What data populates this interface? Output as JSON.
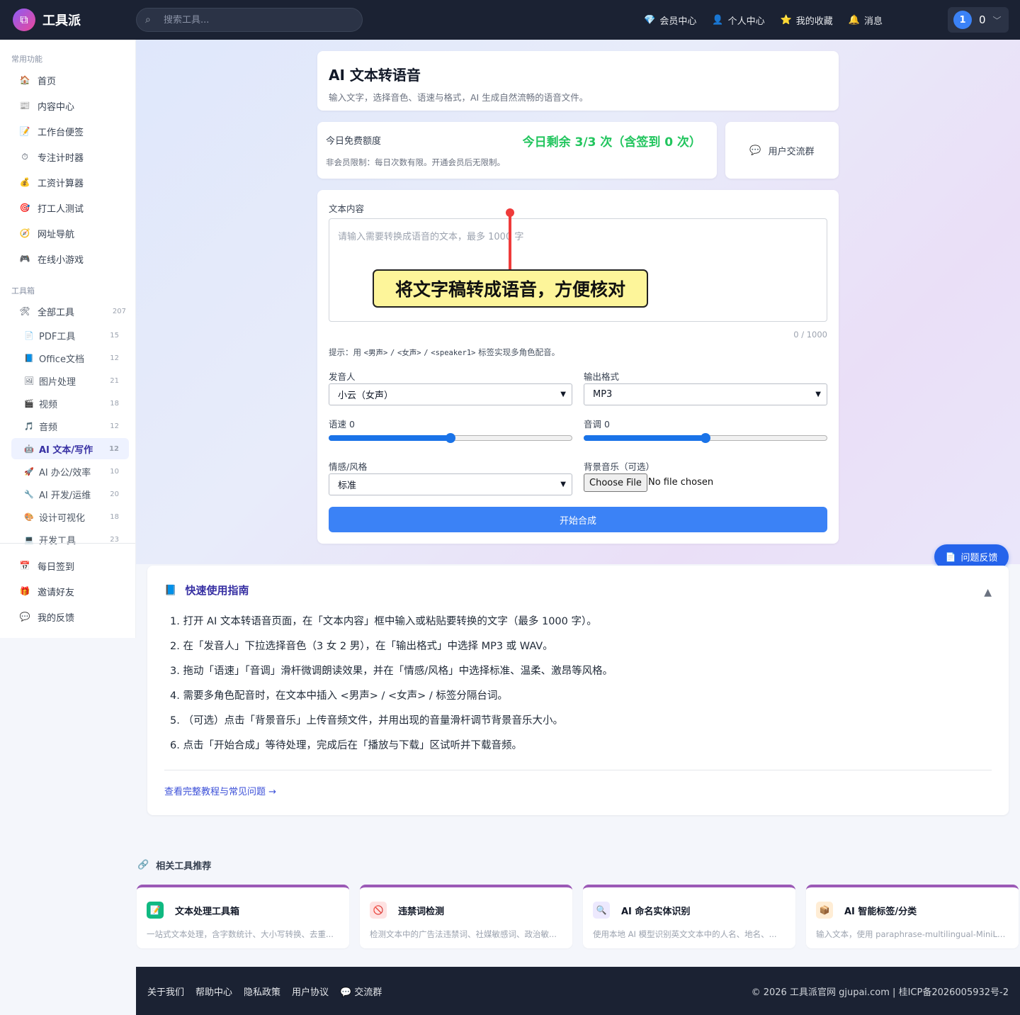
{
  "header": {
    "brand": "工具派",
    "search_placeholder": "搜索工具...",
    "nav": [
      {
        "icon": "diamond-icon",
        "glyph": "💎",
        "label": "会员中心"
      },
      {
        "icon": "user-icon",
        "glyph": "👤",
        "label": "个人中心"
      },
      {
        "icon": "star-icon",
        "glyph": "⭐",
        "label": "我的收藏"
      },
      {
        "icon": "bell-icon",
        "glyph": "🔔",
        "label": "消息"
      }
    ],
    "user": {
      "avatar": "1",
      "count": "0"
    }
  },
  "sidebar": {
    "section_common": "常用功能",
    "common": [
      {
        "glyph": "🏠",
        "label": "首页"
      },
      {
        "glyph": "📰",
        "label": "内容中心"
      },
      {
        "glyph": "📝",
        "label": "工作台便签"
      },
      {
        "glyph": "⏱",
        "label": "专注计时器"
      },
      {
        "glyph": "💰",
        "label": "工资计算器"
      },
      {
        "glyph": "🎯",
        "label": "打工人测试"
      },
      {
        "glyph": "🧭",
        "label": "网址导航"
      },
      {
        "glyph": "🎮",
        "label": "在线小游戏"
      }
    ],
    "section_tools": "工具箱",
    "all_tools": {
      "glyph": "🛠",
      "label": "全部工具",
      "count": "207"
    },
    "categories": [
      {
        "glyph": "📄",
        "label": "PDF工具",
        "count": "15"
      },
      {
        "glyph": "📘",
        "label": "Office文档",
        "count": "12"
      },
      {
        "glyph": "🖼",
        "label": "图片处理",
        "count": "21"
      },
      {
        "glyph": "🎬",
        "label": "视频",
        "count": "18"
      },
      {
        "glyph": "🎵",
        "label": "音频",
        "count": "12"
      },
      {
        "glyph": "🤖",
        "label": "AI 文本/写作",
        "count": "12",
        "active": true
      },
      {
        "glyph": "🚀",
        "label": "AI 办公/效率",
        "count": "10"
      },
      {
        "glyph": "🔧",
        "label": "AI 开发/运维",
        "count": "20"
      },
      {
        "glyph": "🎨",
        "label": "设计可视化",
        "count": "18"
      },
      {
        "glyph": "💻",
        "label": "开发工具",
        "count": "23"
      }
    ],
    "bottom": [
      {
        "glyph": "📅",
        "label": "每日签到"
      },
      {
        "glyph": "🎁",
        "label": "邀请好友"
      },
      {
        "glyph": "💬",
        "label": "我的反馈"
      }
    ]
  },
  "page": {
    "title": "AI 文本转语音",
    "subtitle": "输入文字，选择音色、语速与格式，AI 生成自然流畅的语音文件。"
  },
  "quota": {
    "label": "今日免费额度",
    "remaining": "今日剩余 3/3 次（含签到 0 次）",
    "note": "非会员限制：每日次数有限。开通会员后无限制。"
  },
  "user_group": {
    "label": "用户交流群"
  },
  "form": {
    "text_label": "文本内容",
    "text_placeholder": "请输入需要转换成语音的文本，最多 1000 字",
    "char_count": "0 / 1000",
    "hint_prefix": "提示：用",
    "hint_tag1": "<男声>",
    "hint_sep1": "/",
    "hint_tag2": "<女声>",
    "hint_sep2": "/",
    "hint_tag3": "<speaker1>",
    "hint_suffix": "标签实现多角色配音。",
    "voice_label": "发音人",
    "voice_value": "小云（女声）",
    "format_label": "输出格式",
    "format_value": "MP3",
    "speed_label": "语速 0",
    "speed_level": 0.5,
    "pitch_label": "音调 0",
    "pitch_level": 0.5,
    "emotion_label": "情感/风格",
    "emotion_value": "标准",
    "bgm_label": "背景音乐（可选）",
    "file_button": "Choose File",
    "file_status": "No file chosen",
    "submit": "开始合成"
  },
  "annotation": {
    "text": "将文字稿转成语音，方便核对"
  },
  "feedback_button": "问题反馈",
  "guide": {
    "title": "快速使用指南",
    "steps": [
      "1. 打开 AI 文本转语音页面，在「文本内容」框中输入或粘贴要转换的文字（最多 1000 字）。",
      "2. 在「发音人」下拉选择音色（3 女 2 男），在「输出格式」中选择 MP3 或 WAV。",
      "3. 拖动「语速」「音调」滑杆微调朗读效果，并在「情感/风格」中选择标准、温柔、激昂等风格。",
      "4. 需要多角色配音时，在文本中插入 <男声> / <女声> / 标签分隔台词。",
      "5. （可选）点击「背景音乐」上传音频文件，并用出现的音量滑杆调节背景音乐大小。",
      "6. 点击「开始合成」等待处理，完成后在「播放与下载」区试听并下载音频。"
    ],
    "link": "查看完整教程与常见问题 →"
  },
  "related": {
    "title": "相关工具推荐",
    "items": [
      {
        "name": "文本处理工具箱",
        "desc": "一站式文本处理，含字数统计、大小写转换、去重...",
        "glyph": "📝",
        "bg": "#10b981",
        "fg": "#ffffff"
      },
      {
        "name": "违禁词检测",
        "desc": "检测文本中的广告法违禁词、社媒敏感词、政治敏...",
        "glyph": "🚫",
        "bg": "#fee2e2",
        "fg": "#ef4444"
      },
      {
        "name": "AI 命名实体识别",
        "desc": "使用本地 AI 模型识别英文文本中的人名、地名、...",
        "glyph": "🔍",
        "bg": "#ede9fe",
        "fg": "#8b5cf6"
      },
      {
        "name": "AI 智能标签/分类",
        "desc": "输入文本，使用 paraphrase-multilingual-MiniLM ...",
        "glyph": "📦",
        "bg": "#ffedd5",
        "fg": "#f59e0b"
      }
    ]
  },
  "footer": {
    "links": [
      "关于我们",
      "帮助中心",
      "隐私政策",
      "用户协议",
      "💬 交流群"
    ],
    "copyright": "© 2026 工具派官网 gjupai.com | 桂ICP备2026005932号-2"
  }
}
